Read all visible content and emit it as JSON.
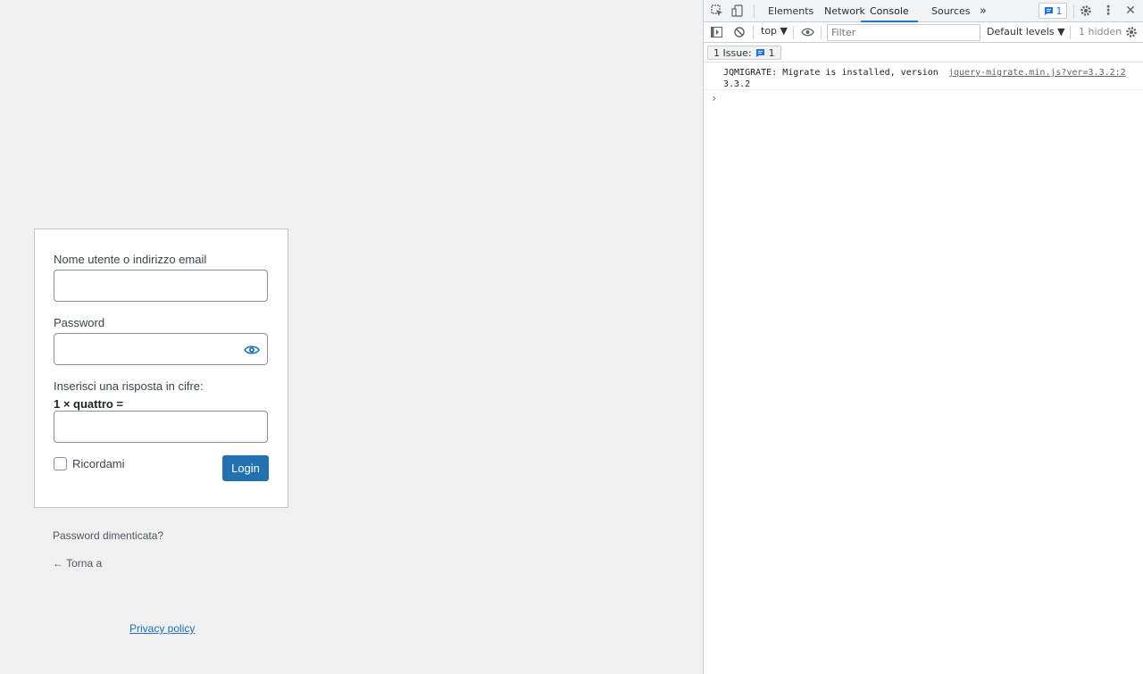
{
  "login": {
    "username_label": "Nome utente o indirizzo email",
    "username_value": "",
    "password_label": "Password",
    "password_value": "",
    "captcha_label": "Inserisci una risposta in cifre:",
    "captcha_question": "1 × quattro =",
    "captcha_value": "",
    "remember_label": "Ricordami",
    "remember_checked": false,
    "login_button": "Login",
    "lost_password_link": "Password dimenticata?",
    "back_link": "← Torna a",
    "privacy_link": "Privacy policy"
  },
  "devtools": {
    "tabs": [
      {
        "label": "Elements",
        "active": false
      },
      {
        "label": "Network",
        "active": false
      },
      {
        "label": "Console",
        "active": true
      },
      {
        "label": "Sources",
        "active": false
      }
    ],
    "more_tabs_glyph": "»",
    "issues_badge_count": "1",
    "context": "top ▼",
    "filter_placeholder": "Filter",
    "levels": "Default levels ▼",
    "hidden": "1 hidden",
    "issues_chip_text": "1 Issue:",
    "issues_chip_count": "1",
    "console_message": "JQMIGRATE: Migrate is installed, version 3.3.2",
    "console_source": "jquery-migrate.min.js?ver=3.3.2:2",
    "prompt": "›",
    "accent_color": "#1a73e8"
  }
}
